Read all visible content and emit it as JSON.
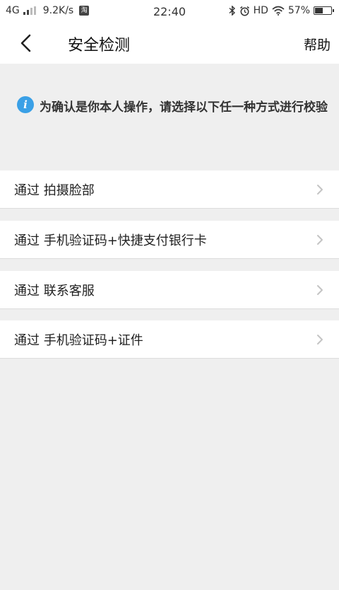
{
  "status_bar": {
    "network": "4G",
    "speed": "9.2K/s",
    "app_badge": "淘",
    "time": "22:40",
    "bluetooth_icon": "bluetooth-icon",
    "alarm_icon": "alarm-icon",
    "hd": "HD",
    "wifi_icon": "wifi-icon",
    "battery_percent": "57%",
    "battery_level": 0.57
  },
  "header": {
    "title": "安全检测",
    "help_label": "帮助",
    "back_icon": "chevron-left-icon"
  },
  "notice": {
    "icon": "info-icon",
    "icon_glyph": "i",
    "text": "为确认是你本人操作，请选择以下任一种方式进行校验"
  },
  "options": [
    {
      "label": "通过 拍摄脸部"
    },
    {
      "label": "通过 手机验证码+快捷支付银行卡"
    },
    {
      "label": "通过 联系客服"
    },
    {
      "label": "通过 手机验证码+证件"
    }
  ],
  "colors": {
    "background": "#efefef",
    "card": "#ffffff",
    "info_blue": "#3aa0e6",
    "chevron": "#c4c4c4"
  }
}
